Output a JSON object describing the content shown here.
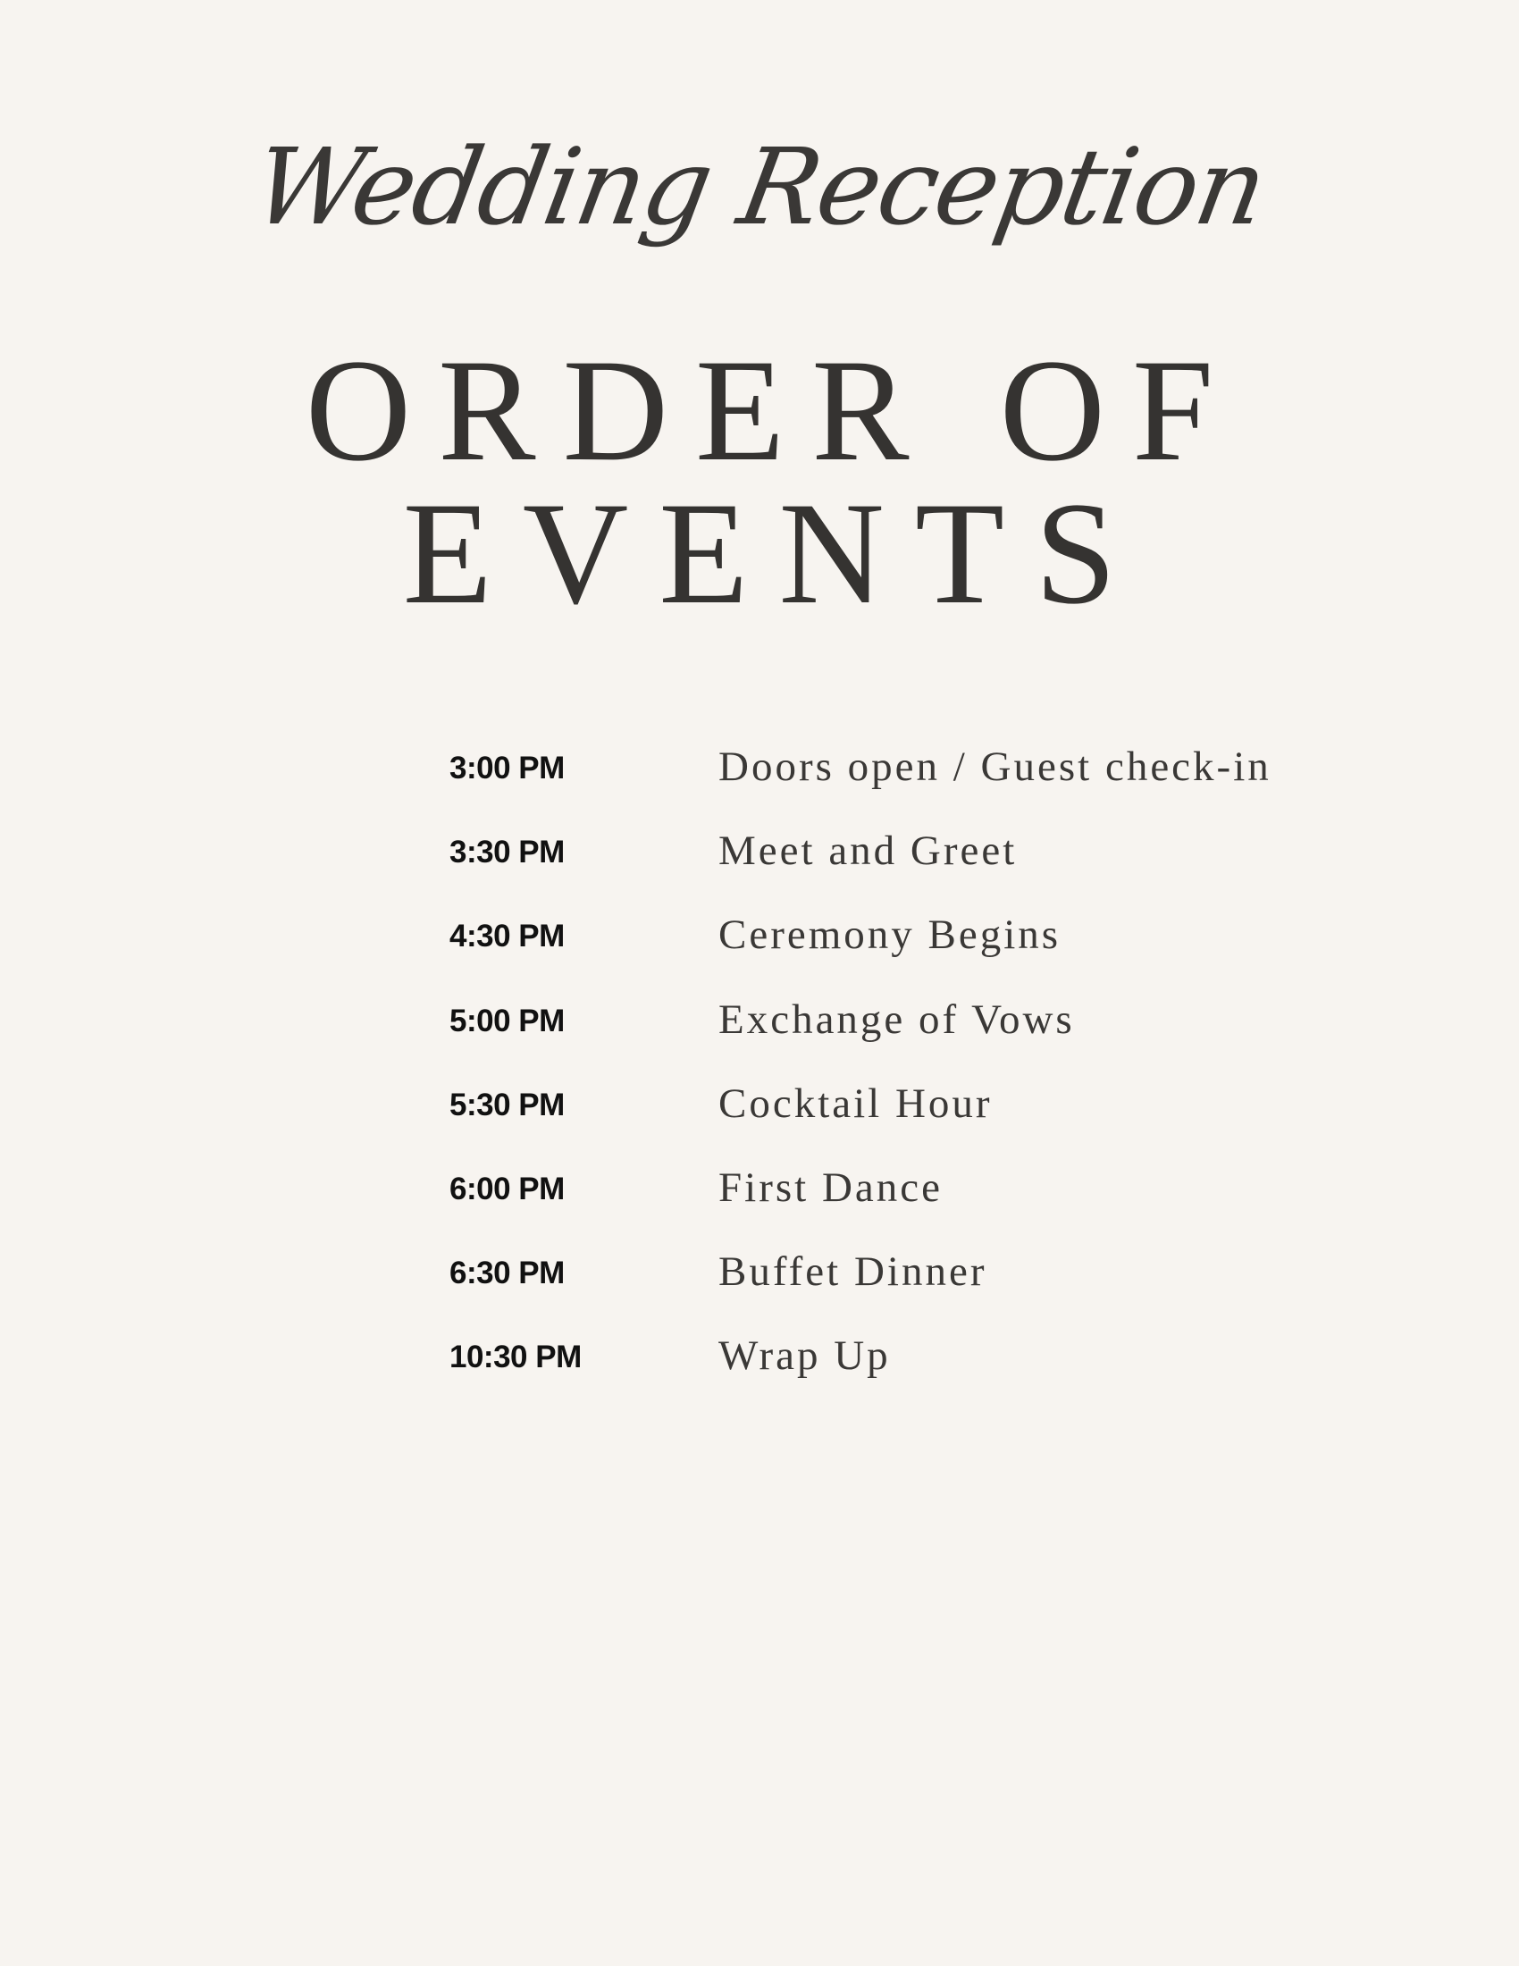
{
  "header": {
    "script_title": "Wedding Reception",
    "title_line1": "ORDER OF",
    "title_line2": "EVENTS"
  },
  "schedule": [
    {
      "time": "3:00 PM",
      "event": "Doors open / Guest check-in"
    },
    {
      "time": "3:30 PM",
      "event": "Meet and Greet"
    },
    {
      "time": "4:30 PM",
      "event": "Ceremony Begins"
    },
    {
      "time": "5:00 PM",
      "event": "Exchange of Vows"
    },
    {
      "time": "5:30 PM",
      "event": "Cocktail Hour"
    },
    {
      "time": "6:00 PM",
      "event": "First Dance"
    },
    {
      "time": "6:30 PM",
      "event": "Buffet Dinner"
    },
    {
      "time": "10:30 PM",
      "event": "Wrap Up"
    }
  ],
  "colors": {
    "background": "#f7f4f0",
    "text": "#373533",
    "time_text": "#111111"
  }
}
